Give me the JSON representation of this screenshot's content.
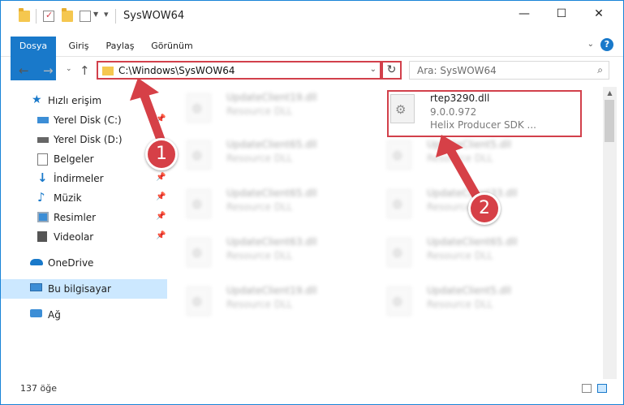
{
  "window": {
    "title": "SysWOW64",
    "minimize": "—",
    "maximize": "☐",
    "close": "✕"
  },
  "ribbon": {
    "tabs": [
      "Dosya",
      "Giriş",
      "Paylaş",
      "Görünüm"
    ],
    "help": "?"
  },
  "nav": {
    "address": "C:\\Windows\\SysWOW64",
    "search_placeholder": "Ara: SysWOW64"
  },
  "sidebar": {
    "items": [
      {
        "label": "Hızlı erişim",
        "icon": "star-icon",
        "color": "#1979ca"
      },
      {
        "label": "Yerel Disk (C:)",
        "icon": "drive-icon",
        "color": "#3c8ed6"
      },
      {
        "label": "Yerel Disk (D:)",
        "icon": "drive-icon",
        "color": "#666666"
      },
      {
        "label": "Belgeler",
        "icon": "documents-icon",
        "color": "#7b7b7b"
      },
      {
        "label": "İndirmeler",
        "icon": "download-icon",
        "color": "#1979ca"
      },
      {
        "label": "Müzik",
        "icon": "music-icon",
        "color": "#1979ca"
      },
      {
        "label": "Resimler",
        "icon": "pictures-icon",
        "color": "#3c8ed6"
      },
      {
        "label": "Videolar",
        "icon": "videos-icon",
        "color": "#555555"
      },
      {
        "label": "OneDrive",
        "icon": "cloud-icon",
        "color": "#1979ca"
      },
      {
        "label": "Bu bilgisayar",
        "icon": "computer-icon",
        "color": "#3c8ed6"
      },
      {
        "label": "Ağ",
        "icon": "network-icon",
        "color": "#3c8ed6"
      }
    ]
  },
  "files": {
    "highlighted": {
      "name": "rtep3290.dll",
      "version": "9.0.0.972",
      "description": "Helix Producer SDK ..."
    },
    "blurred": [
      {
        "name": "UpdateClient19.dll",
        "type": "Resource DLL"
      },
      {
        "name": "UpdateClient65.dll",
        "type": "Resource DLL"
      },
      {
        "name": "UpdateClient5.dll",
        "type": "Resource DLL"
      },
      {
        "name": "UpdateClient65.dll",
        "type": "Resource DLL"
      },
      {
        "name": "UpdateClient33.dll",
        "type": "Resource DLL"
      },
      {
        "name": "UpdateClient63.dll",
        "type": "Resource DLL"
      },
      {
        "name": "UpdateClient65.dll",
        "type": "Resource DLL"
      },
      {
        "name": "UpdateClient19.dll",
        "type": "Resource DLL"
      },
      {
        "name": "UpdateClient5.dll",
        "type": "Resource DLL"
      }
    ]
  },
  "status": {
    "count": "137 öğe"
  },
  "annotations": {
    "step1": "1",
    "step2": "2",
    "accent": "#d64047"
  }
}
